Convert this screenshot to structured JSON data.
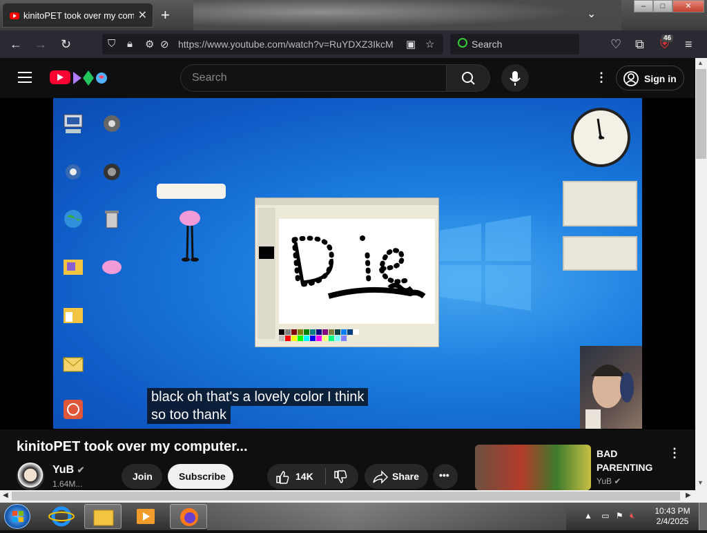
{
  "browser": {
    "tab_title": "kinitoPET took over my computer...",
    "new_tab": "+",
    "tab_list": "⌄",
    "url": "https://www.youtube.com/watch?v=RuYDXZ3IkcM",
    "search_placeholder": "Search",
    "extensions_badge": "46",
    "win_min": "–",
    "win_max": "□",
    "win_close": "✕"
  },
  "youtube": {
    "search_placeholder": "Search",
    "sign_in": "Sign in"
  },
  "video": {
    "subtitle_line1": "black oh that's a lovely color I think",
    "subtitle_line2": "so too thank",
    "paint_text": "Die"
  },
  "details": {
    "title": "kinitoPET took over my computer...",
    "channel": "YuB",
    "subscribers": "1.64M...",
    "join": "Join",
    "subscribe": "Subscribe",
    "likes": "14K",
    "share": "Share"
  },
  "recommendation": {
    "title": "BAD PARENTING",
    "channel": "YuB"
  },
  "taskbar": {
    "time": "10:43 PM",
    "date": "2/4/2025"
  },
  "colors": {
    "youtube_red": "#ff0033",
    "desktop_blue": "#1c7fe0"
  }
}
